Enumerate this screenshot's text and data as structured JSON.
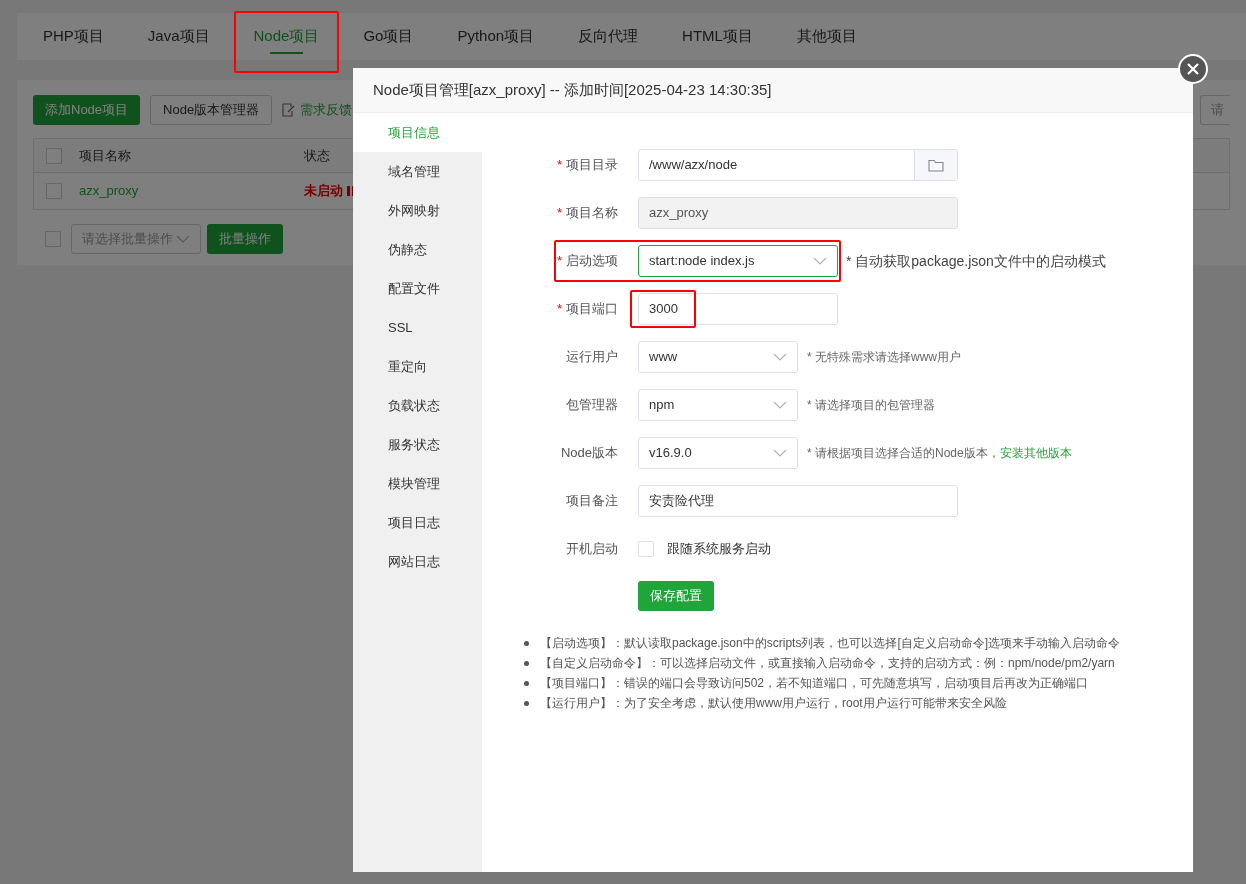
{
  "tabs": [
    {
      "label": "PHP项目",
      "selected": false,
      "highlighted": false
    },
    {
      "label": "Java项目",
      "selected": false,
      "highlighted": false
    },
    {
      "label": "Node项目",
      "selected": true,
      "highlighted": true
    },
    {
      "label": "Go项目",
      "selected": false,
      "highlighted": false
    },
    {
      "label": "Python项目",
      "selected": false,
      "highlighted": false
    },
    {
      "label": "反向代理",
      "selected": false,
      "highlighted": false
    },
    {
      "label": "HTML项目",
      "selected": false,
      "highlighted": false
    },
    {
      "label": "其他项目",
      "selected": false,
      "highlighted": false
    }
  ],
  "toolbar": {
    "add_button": "添加Node项目",
    "version_button": "Node版本管理器",
    "feedback_link": "需求反馈",
    "search_placeholder": "请"
  },
  "table": {
    "select_all_checked": false,
    "columns": [
      "项目名称",
      "状态"
    ],
    "rows": [
      {
        "checked": false,
        "name": "azx_proxy",
        "status": "未启动",
        "running": false
      }
    ]
  },
  "batch": {
    "checked": false,
    "select_placeholder": "请选择批量操作",
    "button": "批量操作"
  },
  "modal": {
    "title": "Node项目管理[azx_proxy] -- 添加时间[2025-04-23 14:30:35]",
    "nav": [
      {
        "label": "项目信息",
        "selected": true
      },
      {
        "label": "域名管理",
        "selected": false
      },
      {
        "label": "外网映射",
        "selected": false
      },
      {
        "label": "伪静态",
        "selected": false
      },
      {
        "label": "配置文件",
        "selected": false
      },
      {
        "label": "SSL",
        "selected": false
      },
      {
        "label": "重定向",
        "selected": false
      },
      {
        "label": "负载状态",
        "selected": false
      },
      {
        "label": "服务状态",
        "selected": false
      },
      {
        "label": "模块管理",
        "selected": false
      },
      {
        "label": "项目日志",
        "selected": false
      },
      {
        "label": "网站日志",
        "selected": false
      }
    ],
    "fields": [
      {
        "kind": "path",
        "required_mark": "*",
        "label": "项目目录",
        "value": "/www/azx/node",
        "highlighted": false
      },
      {
        "kind": "readonly",
        "required_mark": "*",
        "label": "项目名称",
        "value": "azx_proxy",
        "highlighted": false
      },
      {
        "kind": "wide-select",
        "required_mark": "*",
        "label": "启动选项",
        "value": "start:node index.js",
        "focused": true,
        "highlighted": true,
        "hint": "* 自动获取package.json文件中的启动模式"
      },
      {
        "kind": "short-input",
        "required_mark": "*",
        "label": "项目端口",
        "value": "3000",
        "highlighted": true
      },
      {
        "kind": "select",
        "label": "运行用户",
        "value": "www",
        "focused": false,
        "highlighted": false,
        "hint": "* 无特殊需求请选择www用户"
      },
      {
        "kind": "select",
        "label": "包管理器",
        "value": "npm",
        "focused": false,
        "highlighted": false,
        "hint": "* 请选择项目的包管理器"
      },
      {
        "kind": "select",
        "label": "Node版本",
        "value": "v16.9.0",
        "focused": false,
        "highlighted": false,
        "hint": "* 请根据项目选择合适的Node版本，",
        "link": "安装其他版本"
      },
      {
        "kind": "input",
        "label": "项目备注",
        "value": "安责险代理",
        "highlighted": false
      },
      {
        "kind": "checkbox",
        "label": "开机启动",
        "checked": false,
        "text": "跟随系统服务启动",
        "highlighted": false
      }
    ],
    "save_button": "保存配置",
    "notes": [
      "【启动选项】：默认读取package.json中的scripts列表，也可以选择[自定义启动命令]选项来手动输入启动命令",
      "【自定义启动命令】：可以选择启动文件，或直接输入启动命令，支持的启动方式：例：npm/node/pm2/yarn",
      "【项目端口】：错误的端口会导致访问502，若不知道端口，可先随意填写，启动项目后再改为正确端口",
      "【运行用户】：为了安全考虑，默认使用www用户运行，root用户运行可能带来安全风险"
    ]
  }
}
